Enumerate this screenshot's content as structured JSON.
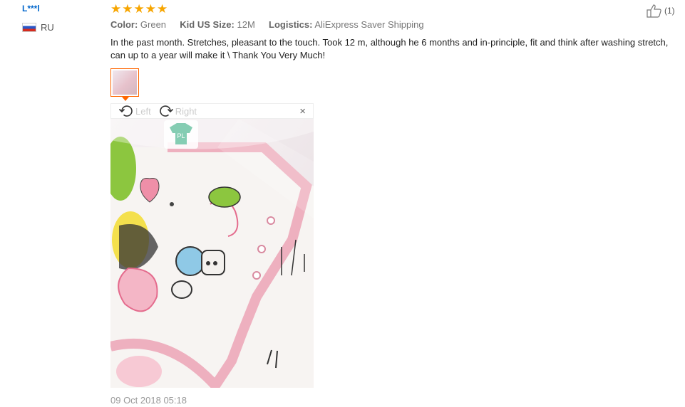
{
  "reviewer": {
    "name": "L***l",
    "country": "RU"
  },
  "rating": {
    "stars": 5
  },
  "attributes": {
    "color_label": "Color:",
    "color_value": "Green",
    "size_label": "Kid US Size:",
    "size_value": "12M",
    "logistics_label": "Logistics:",
    "logistics_value": "AliExpress Saver Shipping"
  },
  "helpful": {
    "count": "(1)",
    "icon": "thumbs-up-icon"
  },
  "review_text": "In the past month. Stretches, pleasant to the touch. Took 12 m, although he 6 months and in-principle, fit and think after washing stretch, can up to a year will make it \\ Thank You Very Much!",
  "viewer": {
    "rotate_left": "Left",
    "rotate_right": "Right",
    "close": "×"
  },
  "photo_tag": "PL",
  "date": "09 Oct 2018 05:18",
  "colors": {
    "accent": "#ff6600",
    "star": "#f7a500",
    "link": "#0066cc"
  }
}
